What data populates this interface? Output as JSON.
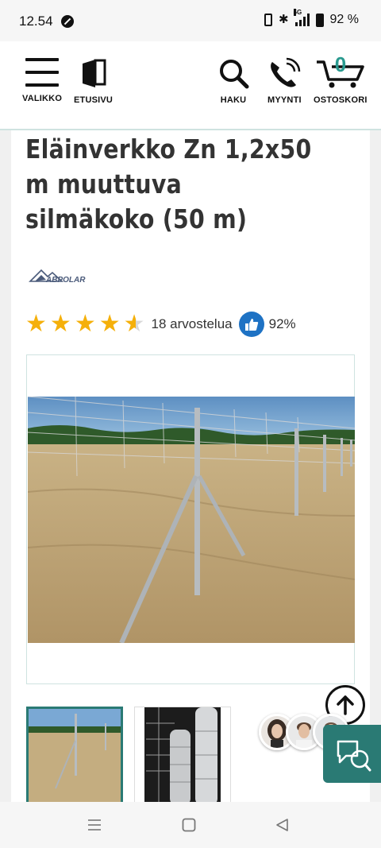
{
  "status_bar": {
    "time": "12.54",
    "battery": "92 %",
    "network": "5G"
  },
  "header": {
    "menu_label": "VALIKKO",
    "home_label": "ETUSIVU",
    "search_label": "HAKU",
    "sales_label": "MYYNTI",
    "cart_label": "OSTOSKORI",
    "cart_count": "0"
  },
  "product": {
    "title": "Eläinverkko Zn 1,2x50 m muuttuva silmäkoko (50 m)",
    "brand_logo": "ABPOLAR",
    "rating_value": 4.5,
    "reviews_text": "18 arvostelua",
    "recommend_percent": "92%"
  },
  "colors": {
    "accent": "#2a7a74",
    "star": "#f5b00a",
    "thumb_badge": "#1e72c4",
    "divider": "#cfe3e0"
  },
  "icons": {
    "menu": "hamburger-icon",
    "home": "door-icon",
    "search": "search-icon",
    "sales": "phone-icon",
    "cart": "cart-icon",
    "scroll_top": "arrow-up-icon",
    "chat": "chat-icon",
    "recommend": "thumbs-up-icon"
  }
}
